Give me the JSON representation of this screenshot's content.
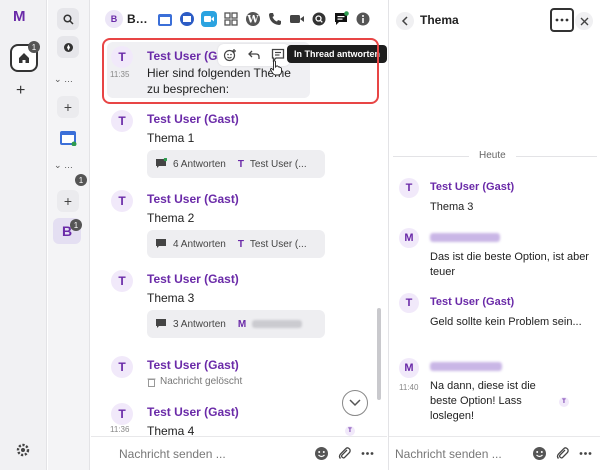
{
  "rail": {
    "logo": "M",
    "home_badge": "1",
    "group_badge": "1"
  },
  "rail2": {
    "group1_label": "…",
    "group2_label": "…",
    "space_letter": "B",
    "space_badge": "1",
    "group2_badge": "1"
  },
  "toolbar": {
    "avatar": "B",
    "title": "B…",
    "icons": [
      "calendar-icon",
      "calendar-grid-icon",
      "video-icon",
      "grid-icon",
      "wordpress-icon",
      "phone-icon",
      "camera-icon",
      "search-icon",
      "chat-icon",
      "info-icon"
    ]
  },
  "messages": {
    "m0": {
      "avatar": "T",
      "sender": "Test User (Gast)",
      "time": "11:35",
      "line1": "Hier sind folgenden Theme",
      "line2": "zu besprechen:"
    },
    "m1": {
      "avatar": "T",
      "sender": "Test User (Gast)",
      "body": "Thema 1",
      "replies": "6 Antworten",
      "reply_avatar": "T",
      "reply_name": "Test User (..."
    },
    "m2": {
      "avatar": "T",
      "sender": "Test User (Gast)",
      "body": "Thema 2",
      "replies": "4 Antworten",
      "reply_avatar": "T",
      "reply_name": "Test User (..."
    },
    "m3": {
      "avatar": "T",
      "sender": "Test User (Gast)",
      "body": "Thema 3",
      "replies": "3 Antworten",
      "reply_avatar": "M"
    },
    "m4": {
      "avatar": "T",
      "sender": "Test User (Gast)",
      "deleted": "Nachricht gelöscht"
    },
    "m5": {
      "avatar": "T",
      "sender": "Test User (Gast)",
      "time": "11:36",
      "body": "Thema 4",
      "read_avatar": "T"
    }
  },
  "tooltip": "In Thread antworten",
  "composer": {
    "placeholder": "Nachricht senden ..."
  },
  "thread": {
    "title": "Thema",
    "divider": "Heute",
    "t1": {
      "avatar": "T",
      "sender": "Test User (Gast)",
      "body": "Thema 3"
    },
    "t2": {
      "avatar": "M",
      "body": "Das ist die beste Option, ist aber teuer"
    },
    "t3": {
      "avatar": "T",
      "sender": "Test User (Gast)",
      "body": "Geld sollte kein Problem sein..."
    },
    "t4": {
      "avatar": "M",
      "time": "11:40",
      "body": "Na dann, diese ist die beste Option! Lass loslegen!",
      "read_avatar": "T"
    },
    "composer_placeholder": "Nachricht senden ..."
  },
  "colors": {
    "accent": "#6a2aa8",
    "highlight": "#e84545"
  }
}
